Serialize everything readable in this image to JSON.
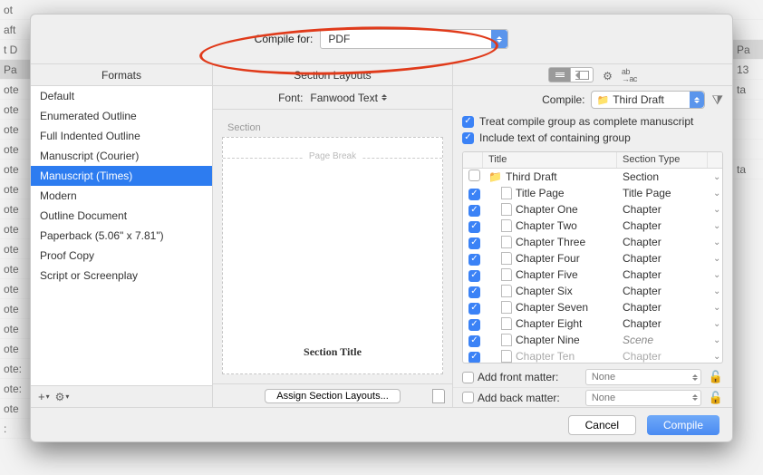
{
  "compile_for": {
    "label": "Compile for:",
    "value": "PDF"
  },
  "formats": {
    "header": "Formats",
    "items": [
      "Default",
      "Enumerated Outline",
      "Full Indented Outline",
      "Manuscript (Courier)",
      "Manuscript (Times)",
      "Modern",
      "Outline Document",
      "Paperback (5.06\" x 7.81\")",
      "Proof Copy",
      "Script or Screenplay"
    ],
    "selected": "Manuscript (Times)"
  },
  "layouts": {
    "header": "Section Layouts",
    "font_label": "Font:",
    "font_value": "Fanwood Text",
    "section_label": "Section",
    "page_break_label": "Page Break",
    "section_title_preview": "Section Title",
    "assign_button": "Assign Section Layouts..."
  },
  "content": {
    "compile_label": "Compile:",
    "compile_value": "Third Draft",
    "treat_group_label": "Treat compile group as complete manuscript",
    "include_text_label": "Include text of containing group",
    "columns": {
      "title": "Title",
      "type": "Section Type"
    },
    "rows": [
      {
        "checked": false,
        "kind": "folder",
        "indent": 0,
        "title": "Third Draft",
        "type": "Section",
        "arrow": true
      },
      {
        "checked": true,
        "kind": "file",
        "indent": 1,
        "title": "Title Page",
        "type": "Title Page",
        "arrow": true
      },
      {
        "checked": true,
        "kind": "file",
        "indent": 1,
        "title": "Chapter One",
        "type": "Chapter",
        "arrow": true
      },
      {
        "checked": true,
        "kind": "file",
        "indent": 1,
        "title": "Chapter Two",
        "type": "Chapter",
        "arrow": true
      },
      {
        "checked": true,
        "kind": "file",
        "indent": 1,
        "title": "Chapter Three",
        "type": "Chapter",
        "arrow": true
      },
      {
        "checked": true,
        "kind": "file",
        "indent": 1,
        "title": "Chapter Four",
        "type": "Chapter",
        "arrow": true
      },
      {
        "checked": true,
        "kind": "file",
        "indent": 1,
        "title": "Chapter Five",
        "type": "Chapter",
        "arrow": true
      },
      {
        "checked": true,
        "kind": "file",
        "indent": 1,
        "title": "Chapter Six",
        "type": "Chapter",
        "arrow": true
      },
      {
        "checked": true,
        "kind": "file",
        "indent": 1,
        "title": "Chapter Seven",
        "type": "Chapter",
        "arrow": true
      },
      {
        "checked": true,
        "kind": "file",
        "indent": 1,
        "title": "Chapter Eight",
        "type": "Chapter",
        "arrow": true
      },
      {
        "checked": true,
        "kind": "file",
        "indent": 1,
        "title": "Chapter Nine",
        "type": "Scene",
        "type_italic": true,
        "arrow": true
      },
      {
        "checked": true,
        "kind": "file",
        "indent": 1,
        "title": "Chapter Ten",
        "type": "Chapter",
        "arrow": true,
        "clipped": true
      }
    ],
    "add_front_label": "Add front matter:",
    "add_back_label": "Add back matter:",
    "matter_none": "None"
  },
  "buttons": {
    "cancel": "Cancel",
    "compile": "Compile"
  }
}
